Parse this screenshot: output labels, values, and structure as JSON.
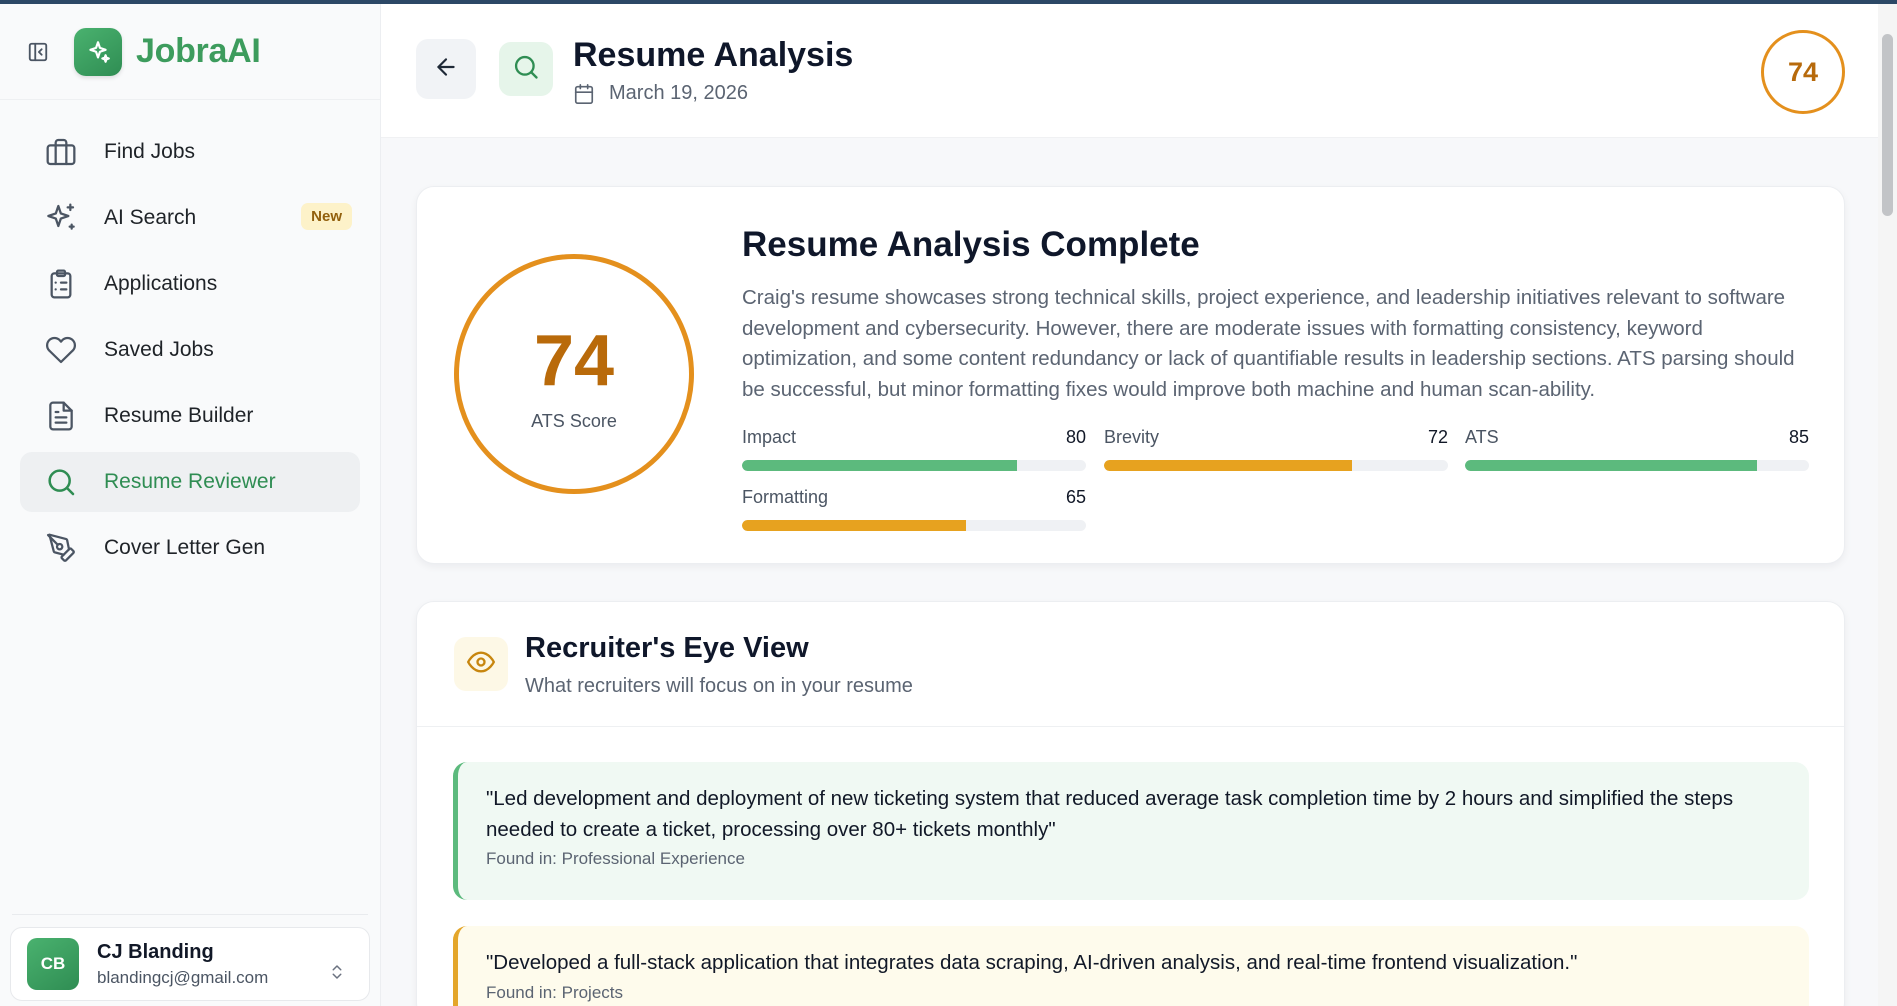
{
  "app": {
    "name": "JobraAI"
  },
  "sidebar": {
    "items": [
      {
        "label": "Find Jobs",
        "icon": "briefcase-icon"
      },
      {
        "label": "AI Search",
        "icon": "sparkles-icon",
        "badge": "New"
      },
      {
        "label": "Applications",
        "icon": "clipboard-list-icon"
      },
      {
        "label": "Saved Jobs",
        "icon": "heart-icon"
      },
      {
        "label": "Resume Builder",
        "icon": "document-icon"
      },
      {
        "label": "Resume Reviewer",
        "icon": "search-icon",
        "active": true
      },
      {
        "label": "Cover Letter Gen",
        "icon": "pen-tool-icon"
      }
    ],
    "user": {
      "initials": "CB",
      "name": "CJ Blanding",
      "email": "blandingcj@gmail.com"
    }
  },
  "header": {
    "title": "Resume Analysis",
    "date": "March 19, 2026",
    "score": "74"
  },
  "summary": {
    "score": "74",
    "score_label": "ATS Score",
    "title": "Resume Analysis Complete",
    "text": "Craig's resume showcases strong technical skills, project experience, and leadership initiatives relevant to software development and cybersecurity. However, there are moderate issues with formatting consistency, keyword optimization, and some content redundancy or lack of quantifiable results in leadership sections. ATS parsing should be successful, but minor formatting fixes would improve both machine and human scan-ability.",
    "metrics": [
      {
        "name": "Impact",
        "value": "80",
        "color": "#5cba7d"
      },
      {
        "name": "Brevity",
        "value": "72",
        "color": "#e7a21f"
      },
      {
        "name": "ATS",
        "value": "85",
        "color": "#5cba7d"
      },
      {
        "name": "Formatting",
        "value": "65",
        "color": "#e7a21f"
      }
    ]
  },
  "recruiter": {
    "title": "Recruiter's Eye View",
    "subtitle": "What recruiters will focus on in your resume",
    "quotes": [
      {
        "text": "\"Led development and deployment of new ticketing system that reduced average task completion time by 2 hours and simplified the steps needed to create a ticket, processing over 80+ tickets monthly\"",
        "source": "Found in: Professional Experience"
      },
      {
        "text": "\"Developed a full-stack application that integrates data scraping, AI-driven analysis, and real-time frontend visualization.\"",
        "source": "Found in: Projects"
      }
    ]
  },
  "colors": {
    "brand": "#3d9c5d",
    "score_ring": "#e4901d",
    "score_text": "#b96a0a"
  }
}
